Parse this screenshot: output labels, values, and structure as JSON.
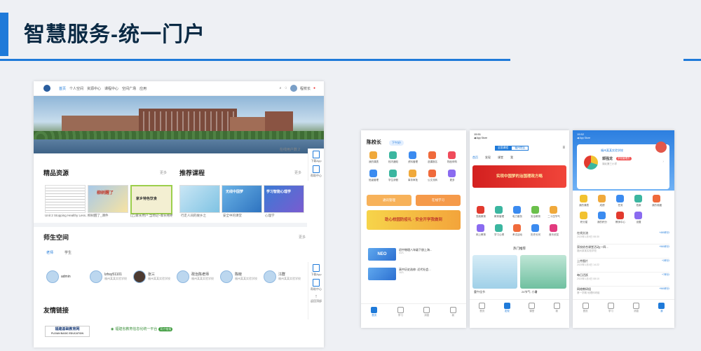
{
  "slide": {
    "title": "智慧服务-统一门户"
  },
  "portal": {
    "nav": [
      "首页",
      "个人空间",
      "资源中心",
      "课程中心",
      "空间广场",
      "应用"
    ],
    "user": "程校长",
    "count_text": "在线用户数 2",
    "sections": {
      "resources": {
        "title": "精品资源",
        "more": "更多"
      },
      "courses": {
        "title": "推荐课程",
        "more": "更多"
      },
      "space": {
        "title": "师生空间",
        "more": "更多",
        "tabs": [
          "老师",
          "学生"
        ]
      },
      "links": {
        "title": "友情链接"
      }
    },
    "resources": [
      {
        "caption": "Unit 2 Stopping Healthy Less..."
      },
      {
        "caption": "柳树醒了_课件",
        "label": "柳树醒了"
      },
      {
        "caption": "(乙)家长用户.当场记~家长格格...",
        "label": "家乡特色饮食"
      }
    ],
    "courses": [
      {
        "caption": "行走人间的故乡之",
        "label": ""
      },
      {
        "caption": "安全中的课堂",
        "label": "无线中国梦"
      },
      {
        "caption": "心理学",
        "label": "学习智能心理学"
      }
    ],
    "people": [
      {
        "name": "admin",
        "school": ""
      },
      {
        "name": "lzhsy51101",
        "school": "福州某某实验学校"
      },
      {
        "name": "张三",
        "school": "福州某某实验学校"
      },
      {
        "name": "政治陈老师",
        "school": "福州某某实验学校"
      },
      {
        "name": "陈晓",
        "school": "福州某某实验学校"
      },
      {
        "name": "江群",
        "school": "福州某某实验学校"
      }
    ],
    "side_top": [
      "下载App",
      "帮助中心"
    ],
    "side_bottom": [
      "下载App",
      "帮助中心",
      "返回顶部"
    ],
    "links": {
      "fj_title": "福建基础教育网",
      "fj_en": "FUJIAN BASIC EDUCATION",
      "edu_text": "福建省教育信息化统一平台",
      "edu_badge": "双方链接"
    }
  },
  "phone1": {
    "header": "陈校长",
    "pill": "下午好!",
    "grid": [
      "我的课表",
      "校内通知",
      "资料管理",
      "选课报名",
      "物品申购",
      "班级管理",
      "学生请假",
      "事务审批",
      "公文流转",
      "更多"
    ],
    "btn_left": "通讯管理",
    "btn_right": "在线学习",
    "banner": "助心校园防疫礼 · 安全开学我做到",
    "news": [
      {
        "thumb": "NEO",
        "title": "初中物理八年级下册上海...",
        "meta": "43人"
      },
      {
        "thumb": "",
        "title": "高中历史选修: 近代社会...",
        "meta": "18人"
      }
    ],
    "tabs": [
      "首页",
      "学习",
      "消息",
      "我"
    ]
  },
  "phone2": {
    "status": "15:51",
    "store": "◀ App Store",
    "segs": [
      "全国课程",
      "福州地区"
    ],
    "tabs": [
      "首页",
      "发现",
      "课堂",
      "我"
    ],
    "banner": "实现中国梦的治国理政方略",
    "grid": [
      "党政教育",
      "教育管理",
      "电力服务",
      "安全教育",
      "二十四节气",
      "网上教育",
      "学习心得",
      "考试活动",
      "历史长河",
      "音乐欣赏"
    ],
    "hot": "热门推荐",
    "cards": [
      "重午佳节",
      "24节气: 小暑"
    ]
  },
  "phone3": {
    "status": "15:52",
    "store": "◀ App Store",
    "org": "福州某某实验学校",
    "name": "郭强龙",
    "role": "学校管理员",
    "sub": "湖北第三小学",
    "grid": [
      "我的课表",
      "成绩",
      "任务",
      "档案",
      "我的收藏",
      "积分星",
      "我的积分",
      "教师中心",
      "设置"
    ],
    "list": [
      {
        "t": "在线交流",
        "s": "2020年1月9日 08:30",
        "r": "+460积分"
      },
      {
        "t": "家校综合课堂活动(一四...",
        "s": "福州某某实验学校",
        "r": "+960积分"
      },
      {
        "t": "上传图片",
        "s": "2020年1月4日 14:22",
        "r": "+2积分"
      },
      {
        "t": "每日活跃",
        "s": "2020年1月4日 08:10",
        "r": "+7积分"
      },
      {
        "t": "网络教研组",
        "s": "第一学期 地理科研组",
        "r": "+960积分"
      }
    ],
    "tabs": [
      "首页",
      "学习",
      "消息",
      "我"
    ]
  }
}
